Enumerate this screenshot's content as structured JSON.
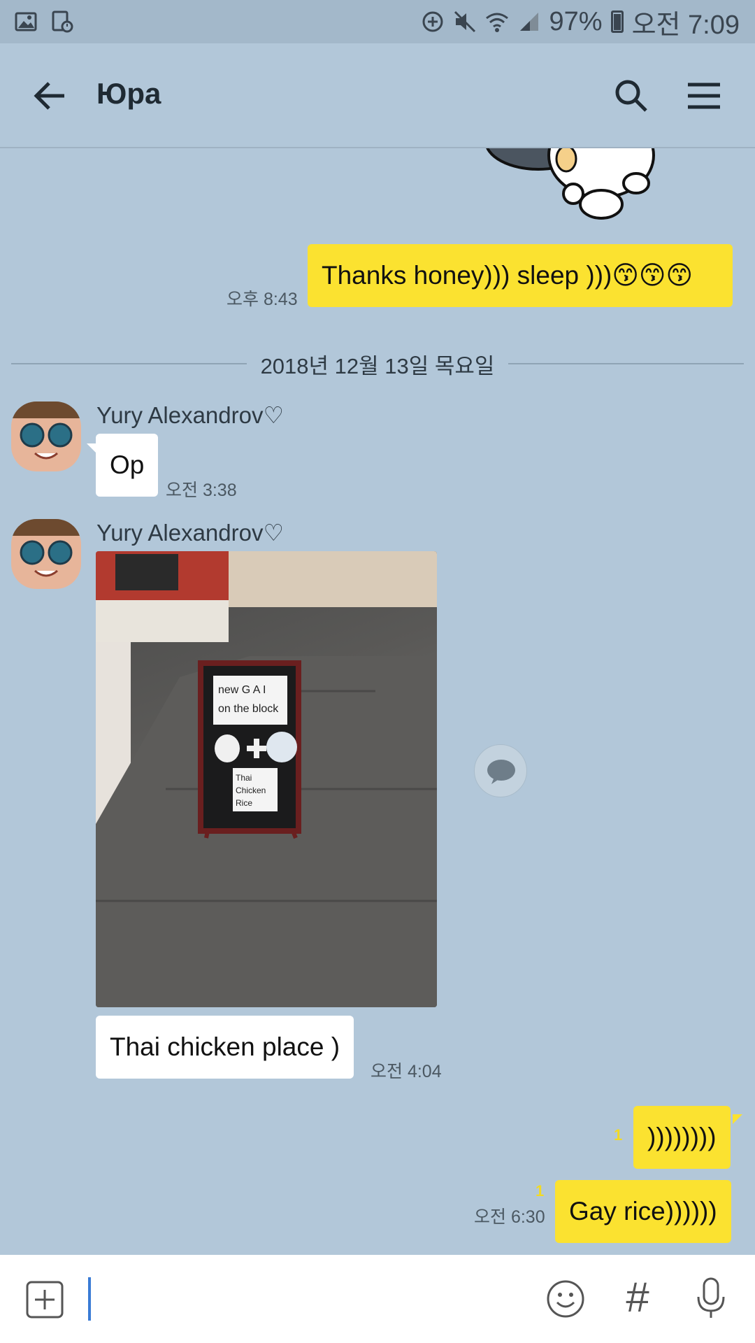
{
  "status_bar": {
    "battery": "97%",
    "time": "오전 7:09"
  },
  "header": {
    "title": "Юра"
  },
  "messages": {
    "m1": {
      "text": "Thanks honey))) sleep )))😙😙😙",
      "time": "오후 8:43"
    },
    "date_divider": "2018년 12월 13일 목요일",
    "m2": {
      "sender": "Yury Alexandrov♡",
      "text": "Op",
      "time": "오전 3:38"
    },
    "m3": {
      "sender": "Yury Alexandrov♡",
      "photo": {
        "sign_top": "new G A I\non the block",
        "sign_bottom": "Thai\nChicken\nRice"
      }
    },
    "m4": {
      "text": "Thai chicken place )",
      "time": "오전 4:04"
    },
    "m5": {
      "text": "))))))))",
      "read_count": "1"
    },
    "m6": {
      "text": "Gay rice))))))",
      "read_count": "1",
      "time": "오전 6:30"
    }
  },
  "input": {
    "placeholder": ""
  },
  "colors": {
    "background": "#b2c7d9",
    "my_bubble": "#fbe230",
    "their_bubble": "#ffffff",
    "read_count": "#f2da24",
    "cursor": "#3a7bd5"
  }
}
